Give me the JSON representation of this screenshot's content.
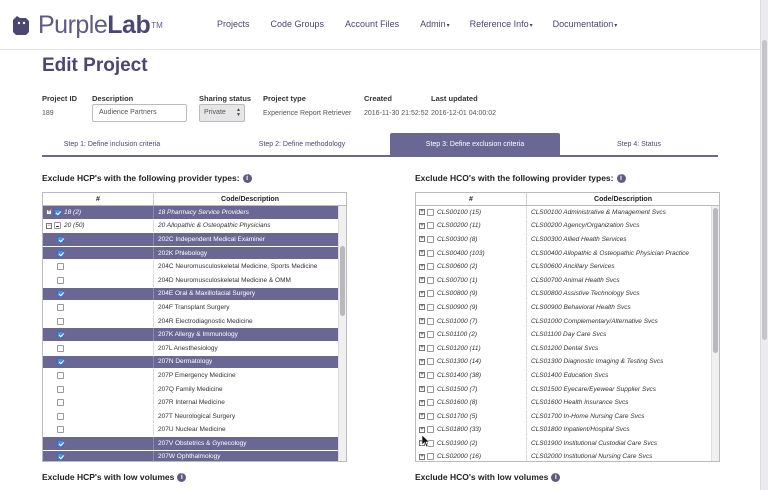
{
  "app": {
    "name_light": "Purple",
    "name_bold": "Lab",
    "tm": "TM"
  },
  "nav": {
    "items": [
      {
        "label": "Projects",
        "caret": ""
      },
      {
        "label": "Code Groups",
        "caret": ""
      },
      {
        "label": "Account Files",
        "caret": ""
      },
      {
        "label": "Admin",
        "caret": "▾"
      },
      {
        "label": "Reference Info",
        "caret": "▾"
      },
      {
        "label": "Documentation",
        "caret": "▾"
      }
    ]
  },
  "page": {
    "title": "Edit Project"
  },
  "project": {
    "id_label": "Project ID",
    "id_value": "189",
    "description_label": "Description",
    "description_value": "Audience Partners",
    "sharing_label": "Sharing status",
    "sharing_value": "Private",
    "type_label": "Project type",
    "type_value": "Experience Report Retriever",
    "created_label": "Created",
    "created_value": "2016-11-30 21:52:52",
    "updated_label": "Last updated",
    "updated_value": "2016-12-01 04:00:02"
  },
  "tabs": [
    {
      "label": "Step 1: Define inclusion criteria",
      "active": false
    },
    {
      "label": "Step 2: Define methodology",
      "active": false
    },
    {
      "label": "Step 3: Define exclusion criteria",
      "active": true
    },
    {
      "label": "Step 4: Status",
      "active": false
    }
  ],
  "hcp": {
    "header": "Exclude HCP's with the following provider types:",
    "col1": "#",
    "col2": "Code/Description",
    "rows": [
      {
        "code": "18 (2)",
        "desc": "18 Pharmacy Service Providers",
        "sel": true,
        "pm": "+",
        "cb": "on",
        "group": true
      },
      {
        "code": "20 (50)",
        "desc": "20 Allopathic & Osteopathic Physicians",
        "sel": false,
        "pm": "−",
        "cb": "part",
        "group": true
      },
      {
        "code": "",
        "desc": "202C Independent Medical Examiner",
        "sel": true,
        "cb": "on"
      },
      {
        "code": "",
        "desc": "202K Phlebology",
        "sel": true,
        "cb": "on"
      },
      {
        "code": "",
        "desc": "204C Neuromusculoskeletal Medicine, Sports Medicine",
        "sel": false,
        "cb": "off"
      },
      {
        "code": "",
        "desc": "204D Neuromusculoskeletal Medicine & OMM",
        "sel": false,
        "cb": "off"
      },
      {
        "code": "",
        "desc": "204E Oral & Maxillofacial Surgery",
        "sel": true,
        "cb": "on"
      },
      {
        "code": "",
        "desc": "204F Transplant Surgery",
        "sel": false,
        "cb": "off"
      },
      {
        "code": "",
        "desc": "204R Electrodiagnostic Medicine",
        "sel": false,
        "cb": "off"
      },
      {
        "code": "",
        "desc": "207K Allergy & Immunology",
        "sel": true,
        "cb": "on"
      },
      {
        "code": "",
        "desc": "207L Anesthesiology",
        "sel": false,
        "cb": "off"
      },
      {
        "code": "",
        "desc": "207N Dermatology",
        "sel": true,
        "cb": "on"
      },
      {
        "code": "",
        "desc": "207P Emergency Medicine",
        "sel": false,
        "cb": "off"
      },
      {
        "code": "",
        "desc": "207Q Family Medicine",
        "sel": false,
        "cb": "off"
      },
      {
        "code": "",
        "desc": "207R Internal Medicine",
        "sel": false,
        "cb": "off"
      },
      {
        "code": "",
        "desc": "207T Neurological Surgery",
        "sel": false,
        "cb": "off"
      },
      {
        "code": "",
        "desc": "207U Nuclear Medicine",
        "sel": false,
        "cb": "off"
      },
      {
        "code": "",
        "desc": "207V Obstetrics & Gynecology",
        "sel": true,
        "cb": "on"
      },
      {
        "code": "",
        "desc": "207W Ophthalmology",
        "sel": true,
        "cb": "on"
      }
    ]
  },
  "hco": {
    "header": "Exclude HCO's with the following provider types:",
    "col1": "#",
    "col2": "Code/Description",
    "rows": [
      {
        "code": "CLS00100 (15)",
        "desc": "CLS00100 Administrative & Management Svcs"
      },
      {
        "code": "CLS00200 (11)",
        "desc": "CLS00200 Agency/Organization Svcs"
      },
      {
        "code": "CLS00300 (8)",
        "desc": "CLS00300 Allied Health Services"
      },
      {
        "code": "CLS00400 (103)",
        "desc": "CLS00400 Allopathic & Osteopathic Physician Practice"
      },
      {
        "code": "CLS00600 (2)",
        "desc": "CLS00600 Ancillary Services"
      },
      {
        "code": "CLS00700 (1)",
        "desc": "CLS00700 Animal Health Svcs"
      },
      {
        "code": "CLS00800 (9)",
        "desc": "CLS00800 Assistive Technology Svcs"
      },
      {
        "code": "CLS00900 (9)",
        "desc": "CLS00900 Behavioral Health Svcs"
      },
      {
        "code": "CLS01000 (7)",
        "desc": "CLS01000 Complementary/Alternative Svcs"
      },
      {
        "code": "CLS01100 (2)",
        "desc": "CLS01100 Day Care Svcs"
      },
      {
        "code": "CLS01200 (11)",
        "desc": "CLS01200 Dental Svcs"
      },
      {
        "code": "CLS01300 (14)",
        "desc": "CLS01300 Diagnostic Imaging & Testing Svcs"
      },
      {
        "code": "CLS01400 (38)",
        "desc": "CLS01400 Education Svcs"
      },
      {
        "code": "CLS01500 (7)",
        "desc": "CLS01500 Eyecare/Eyewear Supplier Svcs"
      },
      {
        "code": "CLS01600 (8)",
        "desc": "CLS01600 Health Insurance Svcs"
      },
      {
        "code": "CLS01700 (5)",
        "desc": "CLS01700 In-Home Nursing Care Svcs"
      },
      {
        "code": "CLS01800 (33)",
        "desc": "CLS01800 Inpatient/Hospital Svcs"
      },
      {
        "code": "CLS01900 (2)",
        "desc": "CLS01900 Institutional Custodial Care Svcs"
      },
      {
        "code": "CLS02000 (16)",
        "desc": "CLS02000 Institutional Nursing Care Svcs"
      }
    ]
  },
  "low_volumes": {
    "hcp": "Exclude HCP's with low volumes",
    "hco": "Exclude HCO's with low volumes"
  },
  "icons": {
    "info": "i"
  },
  "colors": {
    "brand": "#5f5a86",
    "selected_row": "#6a6794",
    "checkbox": "#4e8ee0"
  }
}
